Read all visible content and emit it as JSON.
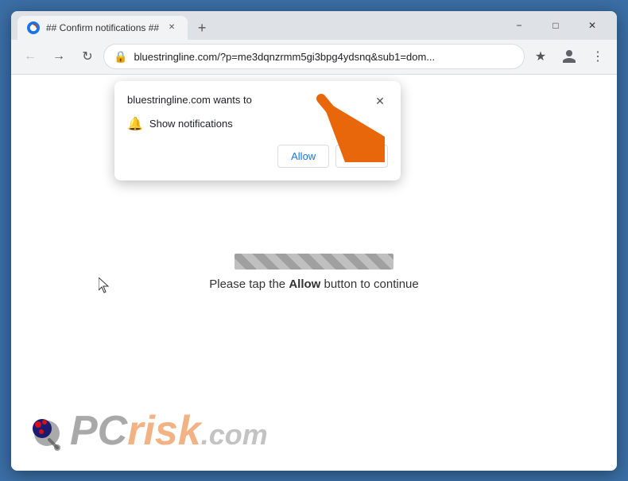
{
  "browser": {
    "tab": {
      "title": "## Confirm notifications ##",
      "favicon_color": "#1a73e8"
    },
    "address_bar": {
      "url": "bluestringline.com/?p=me3dqnzrmm5gi3bpg4ydsnq&sub1=dom...",
      "secure": true
    },
    "window_controls": {
      "minimize": "−",
      "maximize": "□",
      "close": "✕"
    }
  },
  "notification_popup": {
    "title": "bluestringline.com wants to",
    "permission": "Show notifications",
    "allow_button": "Allow",
    "block_button": "Block",
    "close_icon": "✕"
  },
  "page_content": {
    "instruction": "Please tap the ",
    "instruction_bold": "Allow",
    "instruction_end": " button to continue"
  },
  "logo": {
    "pc": "PC",
    "risk": "risk",
    "dot_com": ".com"
  }
}
